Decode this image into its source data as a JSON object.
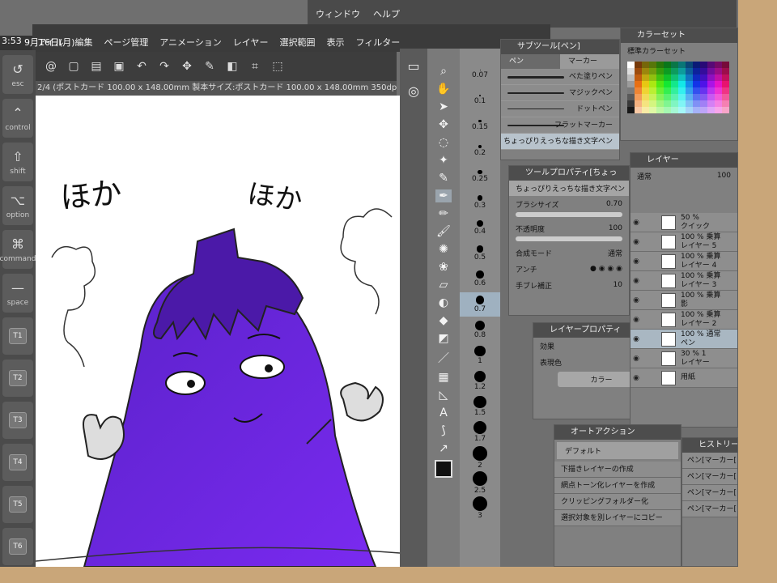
{
  "status": {
    "time": "3:53",
    "date": "9月16日(月)"
  },
  "menu": {
    "items": [
      "アイル",
      "編集",
      "ページ管理",
      "アニメーション",
      "レイヤー",
      "選択範囲",
      "表示",
      "フィルター",
      "ウィンドウ",
      "ヘルプ"
    ]
  },
  "doc": {
    "info": "2/4 (ポストカード 100.00 x 148.00mm 製本サイズ:ポストカード 100.00 x 148.00mm 350dpi 160.7"
  },
  "modifier_keys": [
    {
      "label": "esc",
      "icon": "↺"
    },
    {
      "label": "control",
      "icon": "⌃"
    },
    {
      "label": "shift",
      "icon": "⇧"
    },
    {
      "label": "option",
      "icon": "⌥"
    },
    {
      "label": "command",
      "icon": "⌘"
    },
    {
      "label": "space",
      "icon": "—"
    }
  ],
  "t_keys": [
    "T1",
    "T2",
    "T3",
    "T4",
    "T5",
    "T6"
  ],
  "canvas": {
    "text_left": "ほか",
    "text_right": "ほか"
  },
  "brush_sizes": [
    "0.07",
    "0.1",
    "0.15",
    "0.2",
    "0.25",
    "0.3",
    "0.4",
    "0.5",
    "0.6",
    "0.7",
    "0.8",
    "1",
    "1.2",
    "1.5",
    "1.7",
    "2",
    "2.5",
    "3"
  ],
  "subtool": {
    "title": "サブツール[ペン]",
    "tabs": [
      "ペン",
      "マーカー"
    ],
    "items": [
      "べた塗りペン",
      "マジックペン",
      "ドットペン",
      "フラットマーカー",
      "ちょっぴりえっちな描き文字ペン"
    ]
  },
  "color_set": {
    "title": "カラーセット",
    "name": "標準カラーセット"
  },
  "tool_property": {
    "title": "ツールプロパティ[ちょっ",
    "tool_name": "ちょっぴりえっちな描き文字ペン",
    "brush_size_label": "ブラシサイズ",
    "brush_size": "0.70",
    "opacity_label": "不透明度",
    "opacity": "100",
    "blend_label": "合成モード",
    "blend": "通常",
    "antialias_label": "アンチ",
    "stabilize_label": "手ブレ補正",
    "stabilize": "10"
  },
  "layer_property": {
    "title": "レイヤープロパティ",
    "effect_label": "効果",
    "color_label": "表現色",
    "color_value": "カラー"
  },
  "layers": {
    "title": "レイヤー",
    "blend": "通常",
    "opacity": "100",
    "rows": [
      {
        "top": "50 %",
        "bottom": "クイック"
      },
      {
        "top": "100 % 乗算",
        "bottom": "レイヤー 5"
      },
      {
        "top": "100 % 乗算",
        "bottom": "レイヤー 4"
      },
      {
        "top": "100 % 乗算",
        "bottom": "レイヤー 3"
      },
      {
        "top": "100 % 乗算",
        "bottom": "影"
      },
      {
        "top": "100 % 乗算",
        "bottom": "レイヤー 2"
      },
      {
        "top": "100 % 通常",
        "bottom": "ペン"
      },
      {
        "top": "30 % 1",
        "bottom": "レイヤー"
      },
      {
        "top": "",
        "bottom": "用紙"
      }
    ]
  },
  "auto_action": {
    "title": "オートアクション",
    "set": "デフォルト",
    "items": [
      "下描きレイヤーの作成",
      "網点トーン化レイヤーを作成",
      "クリッピングフォルダー化",
      "選択対象を別レイヤーにコピー"
    ]
  },
  "history": {
    "title": "ヒストリー",
    "items": [
      "ペン[マーカー[ちょっぴりえっちな",
      "ペン[マーカー[ちょっぴりえっちな",
      "ペン[マーカー[ちょっぴりえっちな",
      "ペン[マーカー[ちょっぴりえっちな"
    ]
  },
  "colors": {
    "eggplant": "#6a1fd8",
    "ui_dark": "#4d4d4d",
    "selection": "#a9b7c2"
  }
}
